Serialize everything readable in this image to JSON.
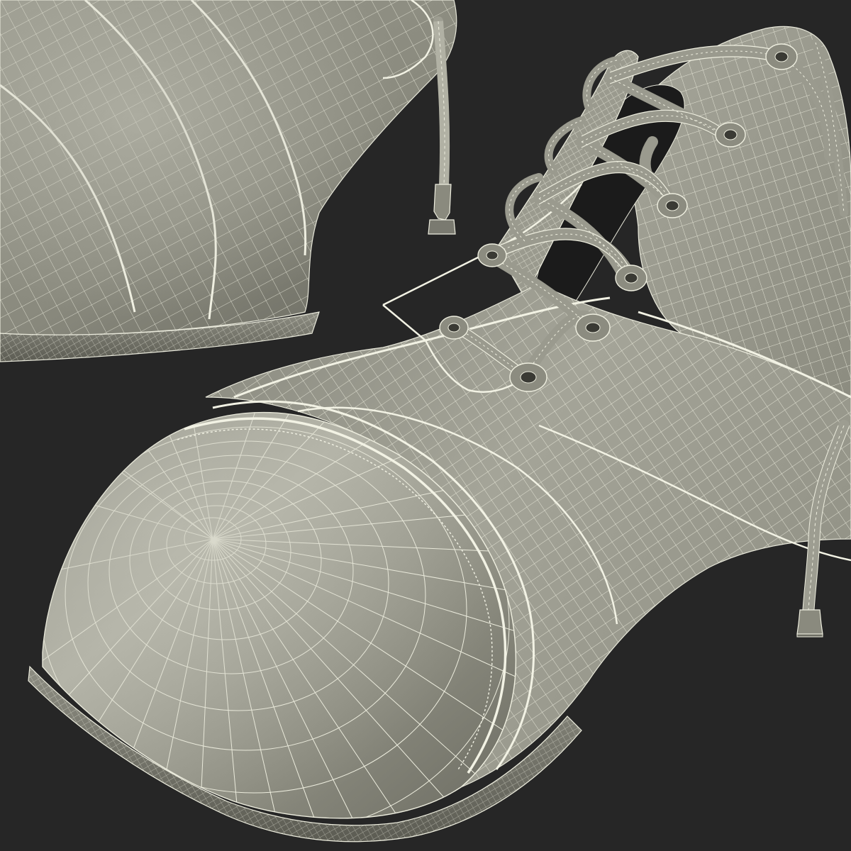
{
  "scene": {
    "subject": "",
    "colors": {
      "background": "#262626",
      "surface_light": "#9a9a8e",
      "surface_mid": "#7e7e72",
      "surface_dark": "#5a5a50",
      "wire": "#e8e8da",
      "shadow": "#1a1a1a"
    },
    "objects": [
      {
        "id": "shoe-back",
        "kind": "shoe"
      },
      {
        "id": "shoe-front",
        "kind": "shoe"
      }
    ]
  }
}
